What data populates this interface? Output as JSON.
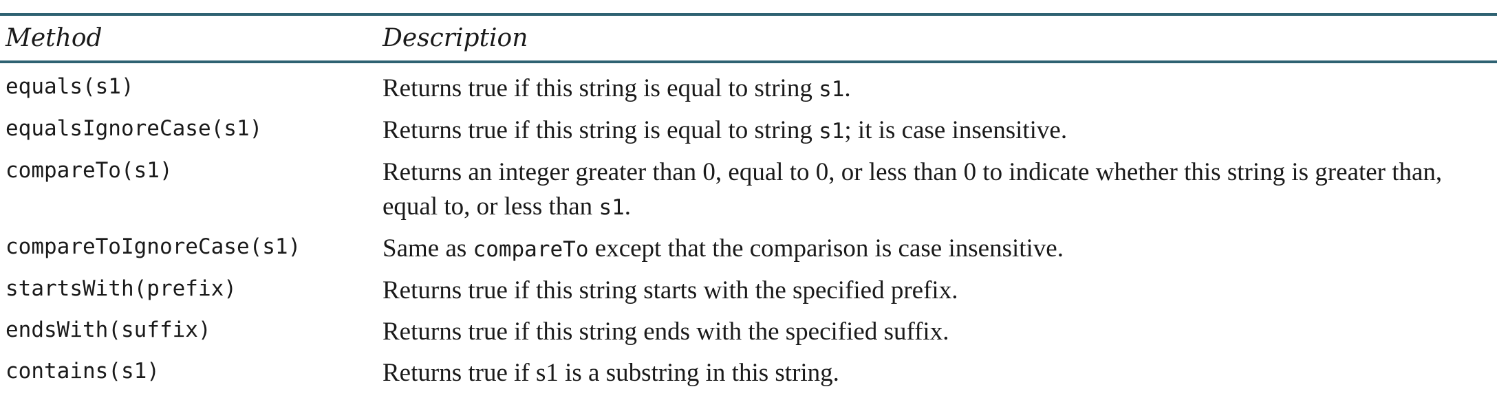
{
  "table": {
    "header": {
      "method": "Method",
      "description": "Description"
    },
    "rows": [
      {
        "method": "equals(s1)",
        "description": [
          {
            "t": "Returns true if this string is equal to string ",
            "mono": false
          },
          {
            "t": "s1",
            "mono": true
          },
          {
            "t": ".",
            "mono": false
          }
        ]
      },
      {
        "method": "equalsIgnoreCase(s1)",
        "description": [
          {
            "t": "Returns true if this string is equal to string ",
            "mono": false
          },
          {
            "t": "s1",
            "mono": true
          },
          {
            "t": "; it is case insensitive.",
            "mono": false
          }
        ]
      },
      {
        "method": "compareTo(s1)",
        "description": [
          {
            "t": "Returns an integer greater than 0, equal to 0, or less than 0 to indicate whether this string is greater than, equal to, or less than ",
            "mono": false
          },
          {
            "t": "s1",
            "mono": true
          },
          {
            "t": ".",
            "mono": false
          }
        ]
      },
      {
        "method": "compareToIgnoreCase(s1)",
        "description": [
          {
            "t": "Same as ",
            "mono": false
          },
          {
            "t": "compareTo",
            "mono": true
          },
          {
            "t": " except that the comparison is case insensitive.",
            "mono": false
          }
        ]
      },
      {
        "method": "startsWith(prefix)",
        "description": [
          {
            "t": "Returns true if this string starts with the specified prefix.",
            "mono": false
          }
        ]
      },
      {
        "method": "endsWith(suffix)",
        "description": [
          {
            "t": "Returns true if this string ends with the specified suffix.",
            "mono": false
          }
        ]
      },
      {
        "method": "contains(s1)",
        "description": [
          {
            "t": "Returns true if s1 is a substring in this string.",
            "mono": false
          }
        ]
      }
    ]
  }
}
